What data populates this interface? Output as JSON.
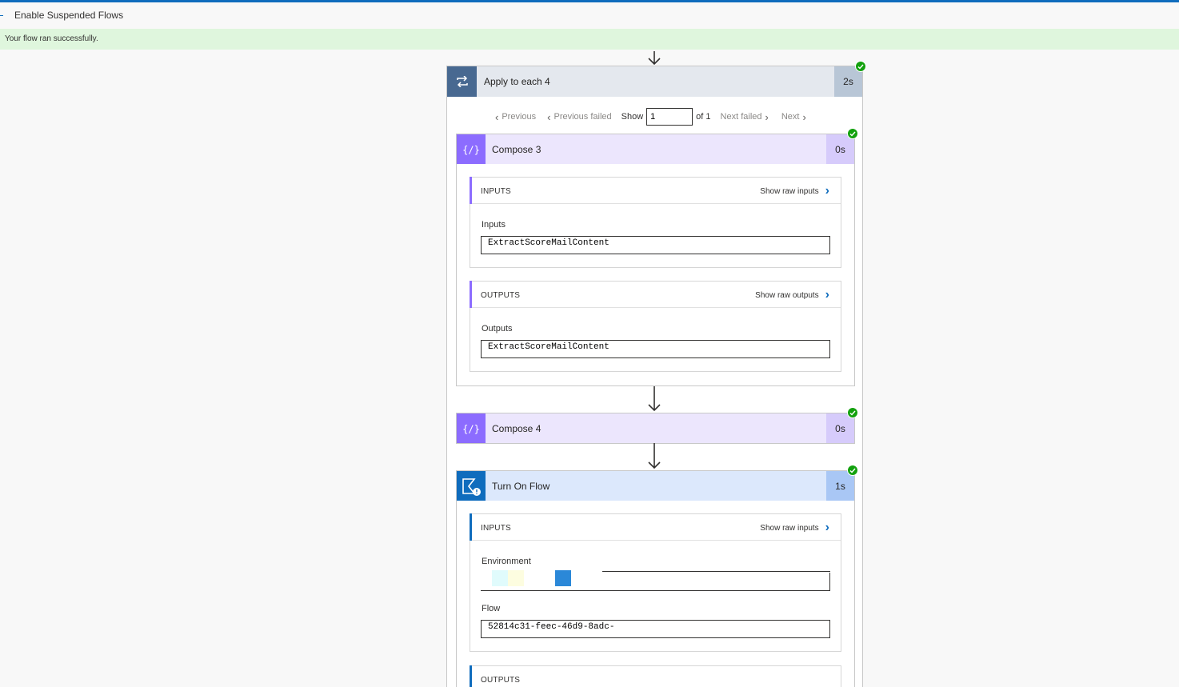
{
  "header": {
    "title": "Enable Suspended Flows"
  },
  "banner": {
    "message": "Your flow ran successfully."
  },
  "apply_each": {
    "label": "Apply to each 4",
    "duration": "2s",
    "pager": {
      "previous": "Previous",
      "previous_failed": "Previous failed",
      "show": "Show",
      "current": "1",
      "of": "of 1",
      "next_failed": "Next failed",
      "next": "Next"
    }
  },
  "compose3": {
    "label": "Compose 3",
    "duration": "0s",
    "inputs": {
      "title": "INPUTS",
      "raw_link": "Show raw inputs",
      "field_label": "Inputs",
      "value": "ExtractScoreMailContent"
    },
    "outputs": {
      "title": "OUTPUTS",
      "raw_link": "Show raw outputs",
      "field_label": "Outputs",
      "value": "ExtractScoreMailContent"
    }
  },
  "compose4": {
    "label": "Compose 4",
    "duration": "0s"
  },
  "turnon": {
    "label": "Turn On Flow",
    "duration": "1s",
    "inputs": {
      "title": "INPUTS",
      "raw_link": "Show raw inputs",
      "env_label": "Environment",
      "flow_label": "Flow",
      "flow_value": "52814c31-feec-46d9-8adc-"
    },
    "outputs": {
      "title": "OUTPUTS"
    }
  },
  "colors": {
    "accent": "#0f6cbd",
    "success": "#13a10e",
    "compose": "#8c6cff",
    "loop": "#486991"
  },
  "icons": [
    "loop-icon",
    "compose-icon",
    "power-automate-icon",
    "check-icon",
    "chevron-right-icon",
    "chevron-left-icon",
    "arrow-down-icon"
  ]
}
